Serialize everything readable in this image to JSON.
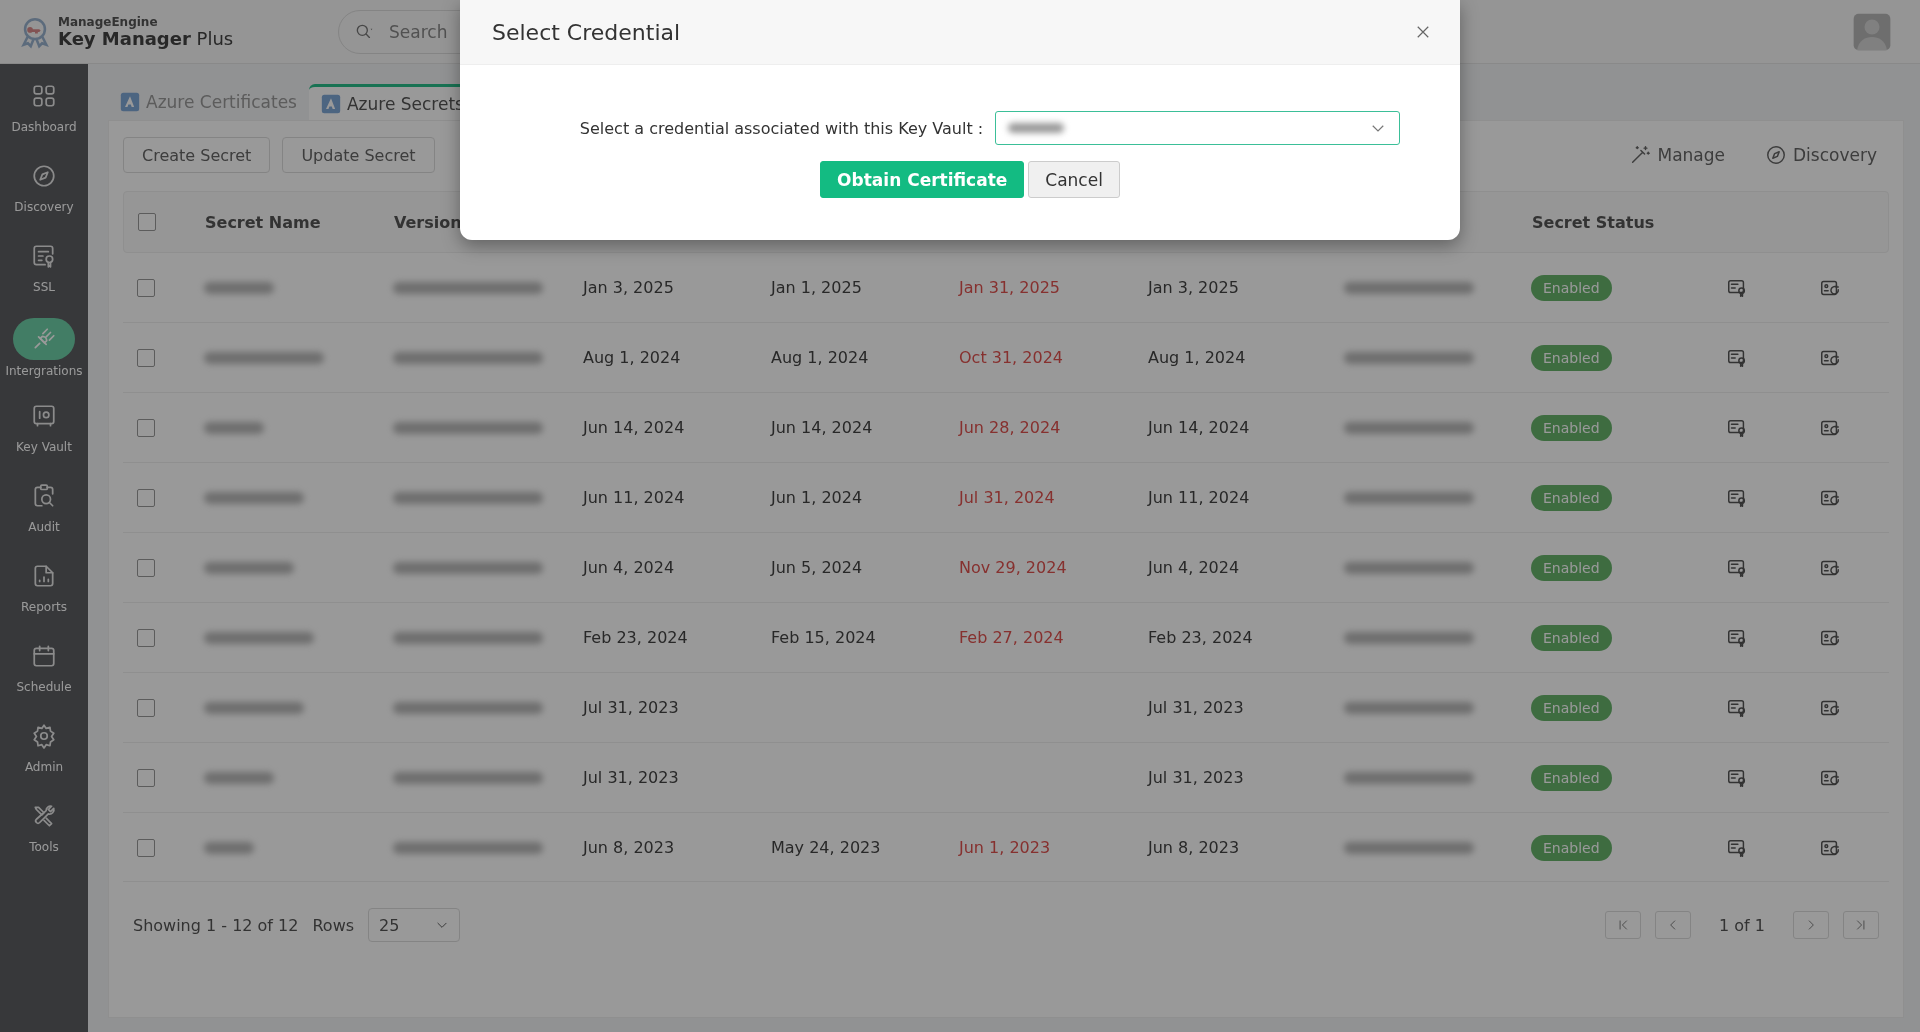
{
  "app": {
    "vendor": "ManageEngine",
    "product_bold": "Key Manager",
    "product_light": "Plus"
  },
  "search": {
    "placeholder": "Search"
  },
  "sidebar": {
    "items": [
      {
        "label": "Dashboard",
        "selected": false
      },
      {
        "label": "Discovery",
        "selected": false
      },
      {
        "label": "SSL",
        "selected": false
      },
      {
        "label": "Intergrations",
        "selected": true
      },
      {
        "label": "Key Vault",
        "selected": false
      },
      {
        "label": "Audit",
        "selected": false
      },
      {
        "label": "Reports",
        "selected": false
      },
      {
        "label": "Schedule",
        "selected": false
      },
      {
        "label": "Admin",
        "selected": false
      },
      {
        "label": "Tools",
        "selected": false
      }
    ]
  },
  "tabs": [
    {
      "label": "Azure Certificates",
      "selected": false
    },
    {
      "label": "Azure Secrets",
      "selected": true
    }
  ],
  "toolbar": {
    "buttons": [
      "Create Secret",
      "Update Secret"
    ],
    "links": [
      "Manage",
      "Discovery"
    ]
  },
  "table": {
    "columns": [
      {
        "kind": "check",
        "checked": false
      },
      {
        "kind": "blurred",
        "label": "Secret Name"
      },
      {
        "kind": "blurred",
        "label": "Version"
      },
      {
        "kind": "date"
      },
      {
        "kind": "date"
      },
      {
        "kind": "alert-date"
      },
      {
        "kind": "date"
      },
      {
        "kind": "blurred"
      },
      {
        "kind": "status",
        "label": "Secret Status"
      },
      {
        "kind": "cert-action"
      },
      {
        "kind": "renew-action"
      }
    ],
    "rows": [
      {
        "checked": false,
        "column_4": "Jan 3, 2025",
        "column_5": "Jan 1, 2025",
        "column_6": "Jan 31, 2025",
        "column_7": "Jan 3, 2025",
        "status": "Enabled"
      },
      {
        "checked": false,
        "column_4": "Aug 1, 2024",
        "column_5": "Aug 1, 2024",
        "column_6": "Oct 31, 2024",
        "column_7": "Aug 1, 2024",
        "status": "Enabled"
      },
      {
        "checked": false,
        "column_4": "Jun 14, 2024",
        "column_5": "Jun 14, 2024",
        "column_6": "Jun 28, 2024",
        "column_7": "Jun 14, 2024",
        "status": "Enabled"
      },
      {
        "checked": false,
        "column_4": "Jun 11, 2024",
        "column_5": "Jun 1, 2024",
        "column_6": "Jul 31, 2024",
        "column_7": "Jun 11, 2024",
        "status": "Enabled"
      },
      {
        "checked": false,
        "column_4": "Jun 4, 2024",
        "column_5": "Jun 5, 2024",
        "column_6": "Nov 29, 2024",
        "column_7": "Jun 4, 2024",
        "status": "Enabled"
      },
      {
        "checked": false,
        "column_4": "Feb 23, 2024",
        "column_5": "Feb 15, 2024",
        "column_6": "Feb 27, 2024",
        "column_7": "Feb 23, 2024",
        "status": "Enabled"
      },
      {
        "checked": false,
        "column_4": "Jul 31, 2023",
        "column_7": "Jul 31, 2023",
        "status": "Enabled"
      },
      {
        "checked": false,
        "column_4": "Jul 31, 2023",
        "column_7": "Jul 31, 2023",
        "status": "Enabled"
      },
      {
        "checked": false,
        "column_4": "Jun 8, 2023",
        "column_5": "May 24, 2023",
        "column_6": "Jun 1, 2023",
        "column_7": "Jun 8, 2023",
        "status": "Enabled"
      }
    ]
  },
  "footer": {
    "showing": "Showing 1 - 12 of 12",
    "rows_label": "Rows",
    "rows_value": "25",
    "page": "1 of 1"
  },
  "dialog": {
    "title": "Select Credential",
    "prompt": "Select a credential associated with this Key Vault :",
    "buttons": [
      {
        "label": "Obtain Certificate",
        "kind": "primary"
      },
      {
        "label": "Cancel",
        "kind": "secondary"
      }
    ]
  }
}
